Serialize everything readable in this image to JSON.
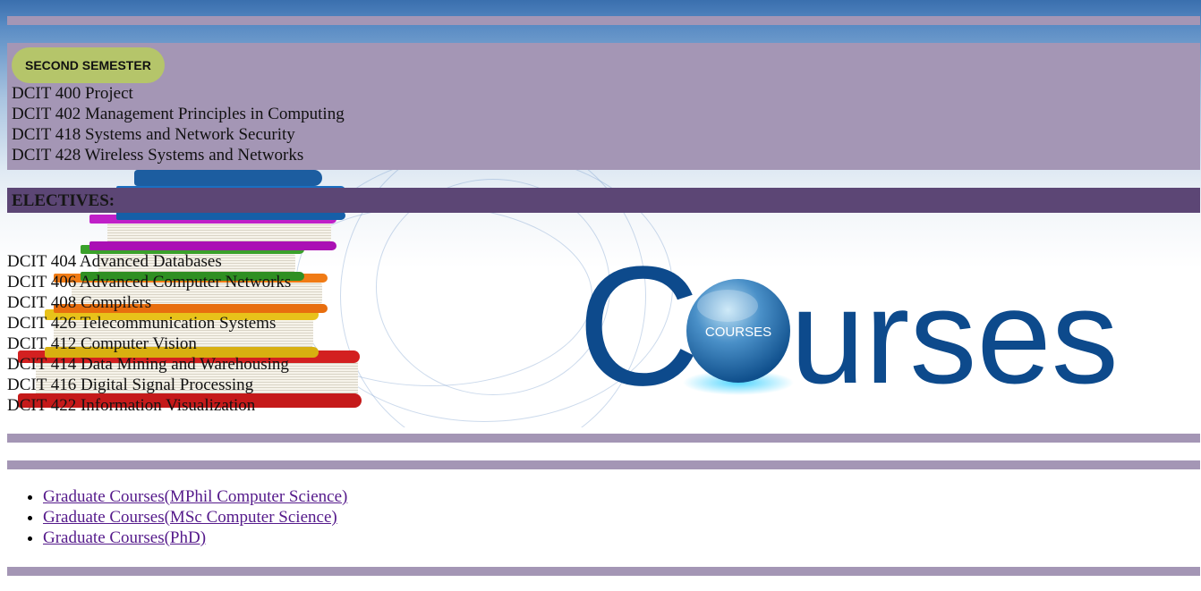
{
  "second_semester": {
    "badge": "SECOND SEMESTER",
    "courses": [
      "DCIT 400 Project",
      "DCIT 402 Management Principles in Computing",
      "DCIT 418 Systems and Network Security",
      "DCIT 428 Wireless Systems and Networks"
    ]
  },
  "electives": {
    "heading": "ELECTIVES:",
    "courses": [
      "DCIT 404 Advanced Databases",
      "DCIT 406 Advanced Computer Networks",
      "DCIT 408 Compilers",
      "DCIT 426 Telecommunication Systems",
      "DCIT 412 Computer Vision",
      "DCIT 414 Data Mining and Warehousing",
      "DCIT 416 Digital Signal Processing",
      "DCIT 422 Information Visualization"
    ]
  },
  "logo": {
    "text_main": "C",
    "text_rest": "urses",
    "globe_label": "COURSES",
    "color": "#0d4a8c"
  },
  "graduate_links": [
    "Graduate Courses(MPhil Computer Science)",
    "Graduate Courses(MSc Computer Science)",
    "Graduate Courses(PhD)"
  ],
  "colors": {
    "panel": "#a496b5",
    "electives_bar": "#5c4675",
    "badge": "#b5c56a",
    "link": "#551a8b"
  }
}
